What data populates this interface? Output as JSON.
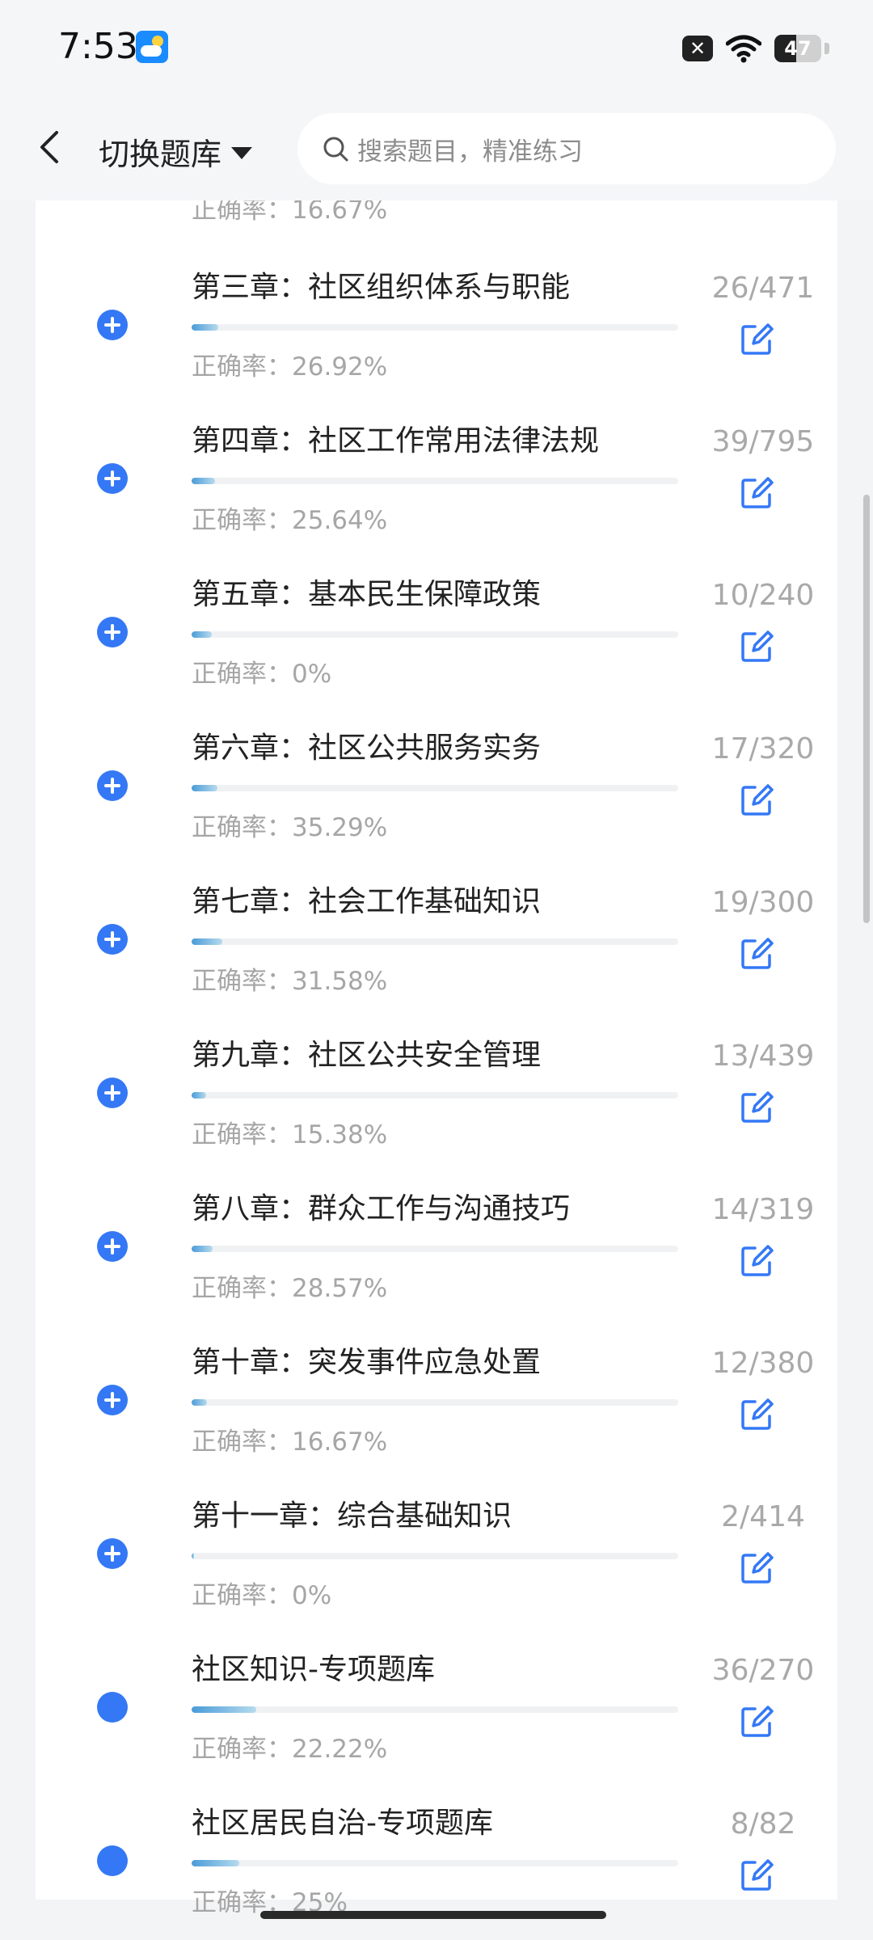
{
  "status_bar": {
    "time": "7:53",
    "weather_icon": "weather-icon",
    "battery": "47"
  },
  "top_bar": {
    "switch_label": "切换题库",
    "search_placeholder": "搜索题目，精准练习"
  },
  "colors": {
    "accent": "#3478f6",
    "progress_start": "#4a9bd8",
    "progress_end": "#b6dbee",
    "muted_text": "#a6a6a6"
  },
  "list": {
    "partial_top": {
      "accuracy": "正确率：16.67%"
    },
    "items": [
      {
        "title": "第三章：社区组织体系与职能",
        "progress": 0.055,
        "accuracy": "正确率：26.92%",
        "count": "26/471",
        "icon": "plus"
      },
      {
        "title": "第四章：社区工作常用法律法规",
        "progress": 0.049,
        "accuracy": "正确率：25.64%",
        "count": "39/795",
        "icon": "plus"
      },
      {
        "title": "第五章：基本民生保障政策",
        "progress": 0.042,
        "accuracy": "正确率：0%",
        "count": "10/240",
        "icon": "plus"
      },
      {
        "title": "第六章：社区公共服务实务",
        "progress": 0.053,
        "accuracy": "正确率：35.29%",
        "count": "17/320",
        "icon": "plus"
      },
      {
        "title": "第七章：社会工作基础知识",
        "progress": 0.063,
        "accuracy": "正确率：31.58%",
        "count": "19/300",
        "icon": "plus"
      },
      {
        "title": "第九章：社区公共安全管理",
        "progress": 0.03,
        "accuracy": "正确率：15.38%",
        "count": "13/439",
        "icon": "plus"
      },
      {
        "title": "第八章：群众工作与沟通技巧",
        "progress": 0.044,
        "accuracy": "正确率：28.57%",
        "count": "14/319",
        "icon": "plus"
      },
      {
        "title": "第十章：突发事件应急处置",
        "progress": 0.032,
        "accuracy": "正确率：16.67%",
        "count": "12/380",
        "icon": "plus"
      },
      {
        "title": "第十一章：综合基础知识",
        "progress": 0.005,
        "accuracy": "正确率：0%",
        "count": "2/414",
        "icon": "plus"
      },
      {
        "title": "社区知识-专项题库",
        "progress": 0.133,
        "accuracy": "正确率：22.22%",
        "count": "36/270",
        "icon": "dot"
      },
      {
        "title": "社区居民自治-专项题库",
        "progress": 0.098,
        "accuracy": "正确率：25%",
        "count": "8/82",
        "icon": "dot"
      }
    ]
  }
}
